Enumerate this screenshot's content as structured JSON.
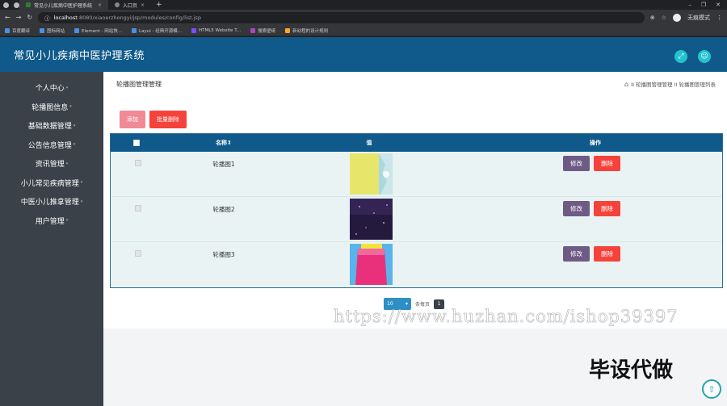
{
  "browser": {
    "tabs": [
      {
        "label": "常见小儿疾病中医护理系统",
        "active": true
      },
      {
        "label": "入口页",
        "active": false
      }
    ],
    "url_host": "localhost",
    "url_path": ":8080/xiaoerzhongyi/jsp/modules/config/list.jsp",
    "profile_label": "无痕模式",
    "bookmarks": [
      "百度翻译",
      "图标网站",
      "Element - 网站快...",
      "Layui - 经典开源模...",
      "HTML5 Website T...",
      "搜索壁纸",
      "新幼程的设计规则"
    ]
  },
  "app": {
    "title": "常见小儿疾病中医护理系统"
  },
  "sidebar": {
    "items": [
      {
        "label": "个人中心"
      },
      {
        "label": "轮播图信息"
      },
      {
        "label": "基础数据管理"
      },
      {
        "label": "公告信息管理"
      },
      {
        "label": "资讯管理"
      },
      {
        "label": "小儿常见疾病管理"
      },
      {
        "label": "中医小儿推拿管理"
      },
      {
        "label": "用户管理"
      }
    ]
  },
  "page": {
    "title": "轮播图管理管理",
    "breadcrumb": "II 轮播图管理管理 II 轮播图管理列表"
  },
  "toolbar": {
    "add_label": "添加",
    "bulk_delete_label": "批量删除"
  },
  "table": {
    "headers": {
      "name": "名称⇕",
      "value": "值",
      "ops": "操作"
    },
    "rows": [
      {
        "name": "轮播图1",
        "edit": "修改",
        "delete": "删除"
      },
      {
        "name": "轮播图2",
        "edit": "修改",
        "delete": "删除"
      },
      {
        "name": "轮播图3",
        "edit": "修改",
        "delete": "删除"
      }
    ]
  },
  "pager": {
    "page_size": "10",
    "per_page_label": "条每页",
    "current_page": "1"
  },
  "watermark": {
    "url_text": "https://www.huzhan.com/ishop39397",
    "cn_text": "毕设代做"
  },
  "colors": {
    "header": "#0f5a8a",
    "sidebar": "#3a4148",
    "accent_cyan": "#22c3cf",
    "edit": "#6d5a85",
    "delete": "#f5433b"
  }
}
